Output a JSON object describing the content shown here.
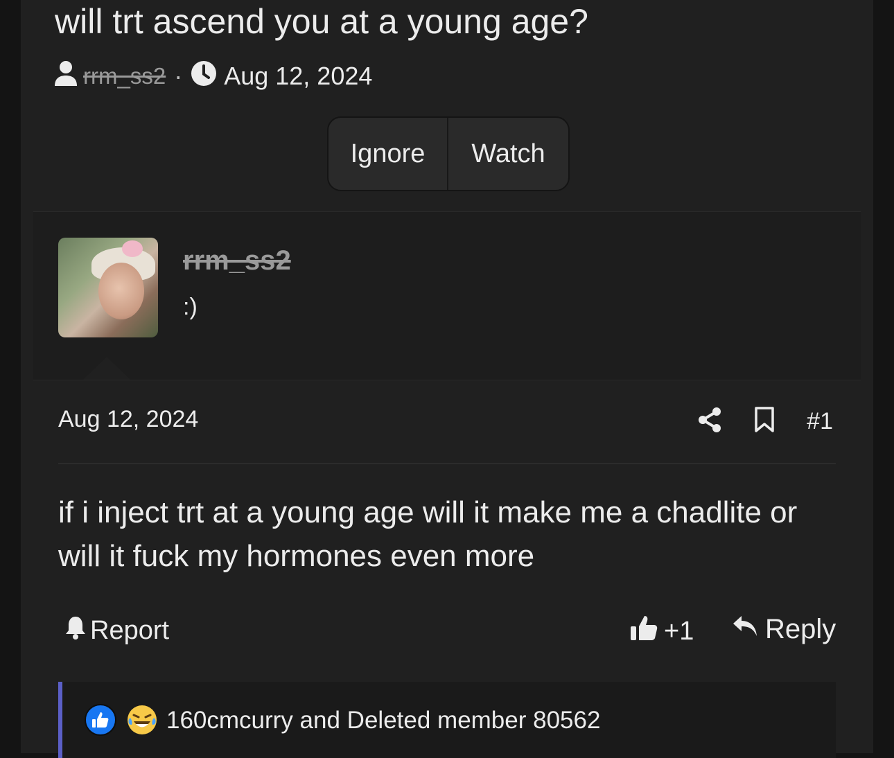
{
  "thread": {
    "title": "will trt ascend you at a young age?",
    "author": "rrm_ss2",
    "separator": "·",
    "date": "Aug 12, 2024"
  },
  "thread_actions": {
    "ignore_label": "Ignore",
    "watch_label": "Watch"
  },
  "post": {
    "author_name": "rrm_ss2",
    "author_title": ":)",
    "date": "Aug 12, 2024",
    "number": "#1",
    "body": "if i inject trt at a young age will it make me a chadlite or will it fuck my hormones even more",
    "report_label": "Report",
    "like_count": "+1",
    "reply_label": "Reply"
  },
  "reactions": {
    "icons": [
      "like-reaction-icon",
      "laugh-cry-reaction-icon"
    ],
    "users_text": "160cmcurry and Deleted member 80562",
    "accent_color": "#5b5fc7"
  }
}
